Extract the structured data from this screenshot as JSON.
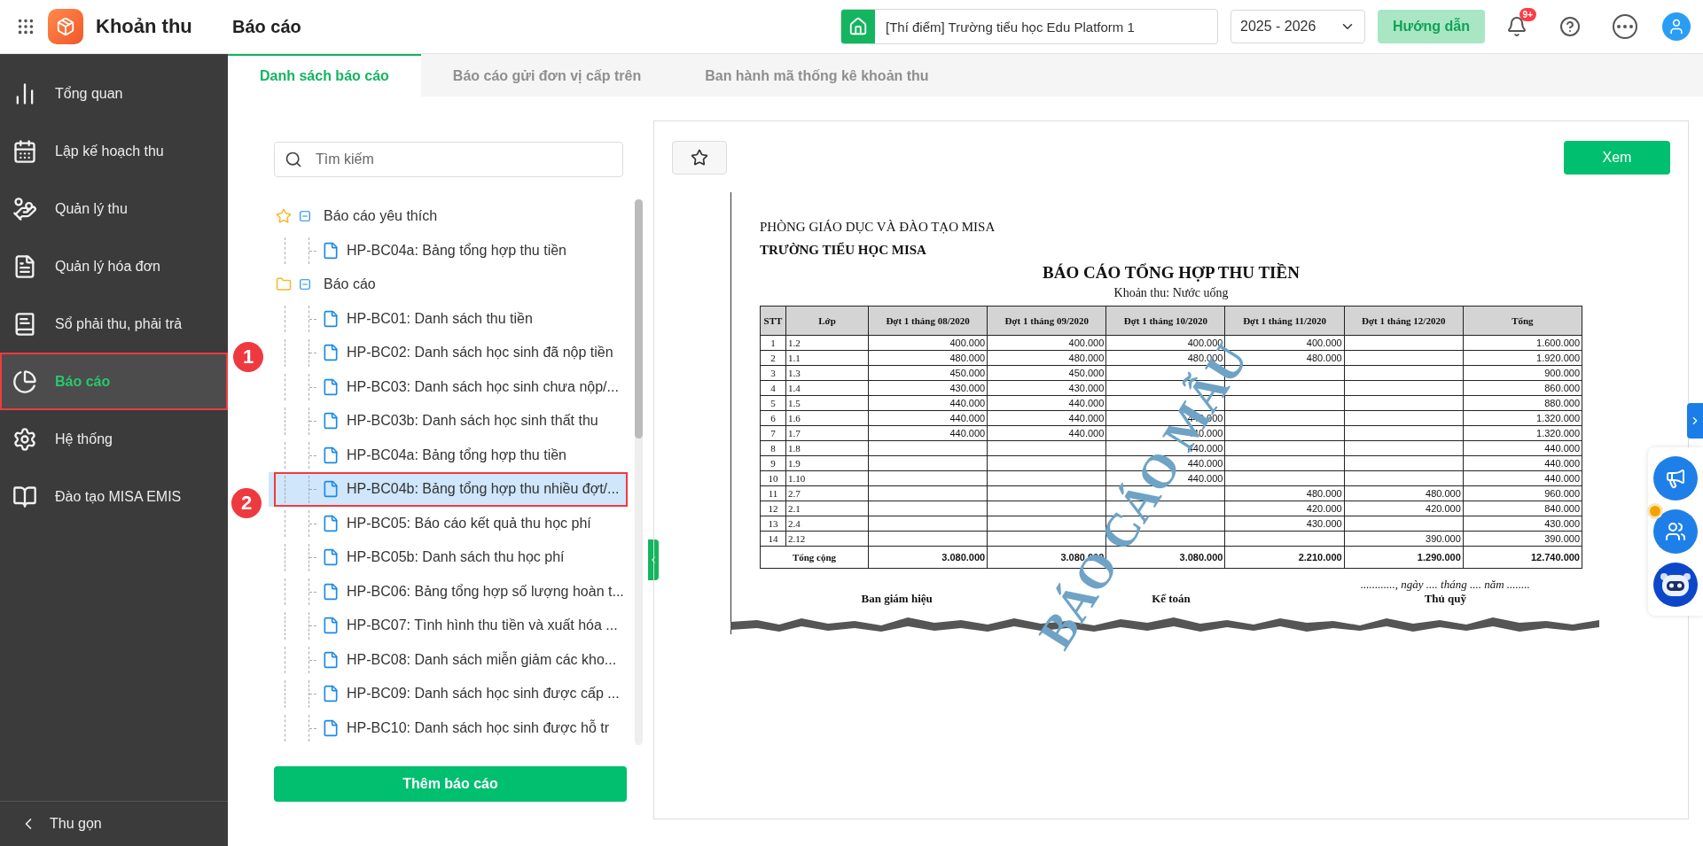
{
  "app": {
    "name": "Khoản thu"
  },
  "header": {
    "page_title": "Báo cáo",
    "school": "[Thí điểm] Trường tiểu học Edu Platform 1",
    "year": "2025 - 2026",
    "guide_button": "Hướng dẫn",
    "notification_badge": "9+"
  },
  "sidebar": {
    "items": [
      {
        "label": "Tổng quan",
        "kind": "overview",
        "selected": false
      },
      {
        "label": "Lập kế hoạch thu",
        "kind": "plan",
        "selected": false
      },
      {
        "label": "Quản lý thu",
        "kind": "collect",
        "selected": false
      },
      {
        "label": "Quản lý hóa đơn",
        "kind": "invoice",
        "selected": false
      },
      {
        "label": "Sổ phải thu, phải trả",
        "kind": "ledger",
        "selected": false
      },
      {
        "label": "Báo cáo",
        "kind": "report",
        "selected": true,
        "callout": "1"
      },
      {
        "label": "Hệ thống",
        "kind": "system",
        "selected": false
      },
      {
        "label": "Đào tạo MISA EMIS",
        "kind": "training",
        "selected": false
      }
    ],
    "collapse": "Thu gọn"
  },
  "tabs": [
    {
      "label": "Danh sách báo cáo",
      "selected": true
    },
    {
      "label": "Báo cáo gửi đơn vị cấp trên",
      "selected": false
    },
    {
      "label": "Ban hành mã thống kê khoản thu",
      "selected": false
    }
  ],
  "report_list": {
    "search_placeholder": "Tìm kiếm",
    "groups": [
      {
        "label": "Báo cáo yêu thích",
        "kind": "favorites",
        "expanded": true,
        "children": [
          {
            "label": "HP-BC04a: Bảng tổng hợp thu tiền",
            "selected": false
          }
        ]
      },
      {
        "label": "Báo cáo",
        "kind": "folder",
        "expanded": true,
        "children": [
          {
            "label": "HP-BC01: Danh sách thu tiền",
            "selected": false
          },
          {
            "label": "HP-BC02: Danh sách học sinh đã nộp tiền",
            "selected": false
          },
          {
            "label": "HP-BC03: Danh sách học sinh chưa nộp/...",
            "selected": false
          },
          {
            "label": "HP-BC03b: Danh sách học sinh thất thu",
            "selected": false
          },
          {
            "label": "HP-BC04a: Bảng tổng hợp thu tiền",
            "selected": false
          },
          {
            "label": "HP-BC04b: Bảng tổng hợp thu nhiều đợt/...",
            "selected": true,
            "callout": "2"
          },
          {
            "label": "HP-BC05: Báo cáo kết quả thu học phí",
            "selected": false
          },
          {
            "label": "HP-BC05b: Danh sách thu học phí",
            "selected": false
          },
          {
            "label": "HP-BC06: Bảng tổng hợp số lượng hoàn t...",
            "selected": false
          },
          {
            "label": "HP-BC07: Tình hình thu tiền và xuất hóa ...",
            "selected": false
          },
          {
            "label": "HP-BC08: Danh sách miễn giảm các kho...",
            "selected": false
          },
          {
            "label": "HP-BC09: Danh sách học sinh được cấp ...",
            "selected": false
          },
          {
            "label": "HP-BC10: Danh sách học sinh được hỗ tr",
            "selected": false
          }
        ]
      }
    ],
    "add_button": "Thêm báo cáo"
  },
  "preview": {
    "starred": false,
    "view_button": "Xem",
    "document": {
      "org": "PHÒNG GIÁO DỤC VÀ ĐÀO TẠO MISA",
      "school": "TRƯỜNG TIỂU HỌC MISA",
      "title": "BÁO CÁO TỔNG HỢP THU TIỀN",
      "subtitle": "Khoản thu: Nước uống",
      "columns": [
        "STT",
        "Lớp",
        "Đợt 1 tháng 08/2020",
        "Đợt 1 tháng 09/2020",
        "Đợt 1 tháng 10/2020",
        "Đợt 1 tháng 11/2020",
        "Đợt 1 tháng 12/2020",
        "Tổng"
      ],
      "rows": [
        [
          "1",
          "1.2",
          "400.000",
          "400.000",
          "400.000",
          "400.000",
          null,
          "1.600.000"
        ],
        [
          "2",
          "1.1",
          "480.000",
          "480.000",
          "480.000",
          "480.000",
          null,
          "1.920.000"
        ],
        [
          "3",
          "1.3",
          "450.000",
          "450.000",
          null,
          null,
          null,
          "900.000"
        ],
        [
          "4",
          "1.4",
          "430.000",
          "430.000",
          null,
          null,
          null,
          "860.000"
        ],
        [
          "5",
          "1.5",
          "440.000",
          "440.000",
          null,
          null,
          null,
          "880.000"
        ],
        [
          "6",
          "1.6",
          "440.000",
          "440.000",
          "440.000",
          null,
          null,
          "1.320.000"
        ],
        [
          "7",
          "1.7",
          "440.000",
          "440.000",
          "440.000",
          null,
          null,
          "1.320.000"
        ],
        [
          "8",
          "1.8",
          null,
          null,
          "440.000",
          null,
          null,
          "440.000"
        ],
        [
          "9",
          "1.9",
          null,
          null,
          "440.000",
          null,
          null,
          "440.000"
        ],
        [
          "10",
          "1.10",
          null,
          null,
          "440.000",
          null,
          null,
          "440.000"
        ],
        [
          "11",
          "2.7",
          null,
          null,
          null,
          "480.000",
          "480.000",
          "960.000"
        ],
        [
          "12",
          "2.1",
          null,
          null,
          null,
          "420.000",
          "420.000",
          "840.000"
        ],
        [
          "13",
          "2.4",
          null,
          null,
          null,
          "430.000",
          null,
          "430.000"
        ],
        [
          "14",
          "2.12",
          null,
          null,
          null,
          null,
          "390.000",
          "390.000"
        ]
      ],
      "total_row": {
        "label": "Tổng cộng",
        "values": [
          "3.080.000",
          "3.080.000",
          "3.080.000",
          "2.210.000",
          "1.290.000",
          "12.740.000"
        ]
      },
      "date_line": "............, ngày .... tháng .... năm ........",
      "signatures": [
        "Ban giám hiệu",
        "Kế toán",
        "Thủ quỹ"
      ],
      "stamp": "BÁO CÁO MẪU"
    }
  },
  "floating_tools": [
    {
      "kind": "announce"
    },
    {
      "kind": "community",
      "dot": true
    },
    {
      "kind": "assistant"
    }
  ]
}
